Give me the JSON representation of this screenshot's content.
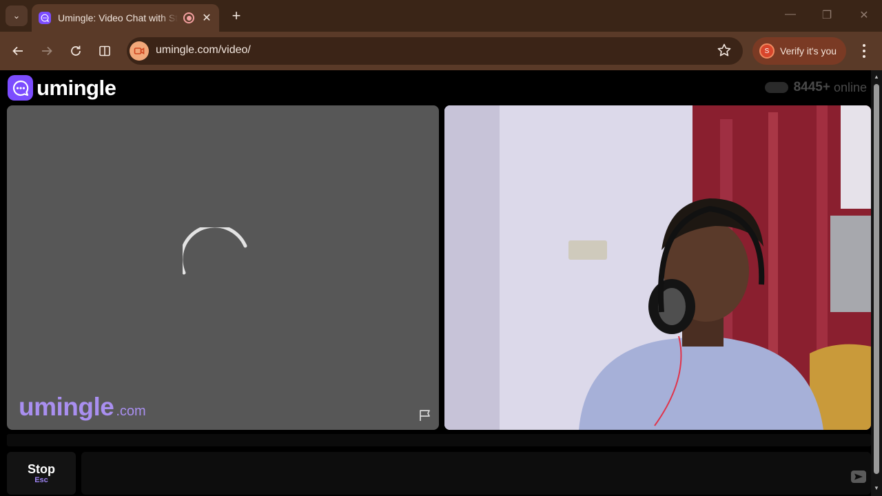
{
  "browser": {
    "tab_title": "Umingle: Video Chat with Strangers",
    "url": "umingle.com/video/",
    "verify_label": "Verify it's you",
    "profile_initial": "S",
    "new_tab_symbol": "+",
    "tab_close_symbol": "✕",
    "tab_search_symbol": "⌄",
    "minimize_symbol": "—",
    "restore_symbol": "❐",
    "close_symbol": "✕"
  },
  "page": {
    "logo_text": "umingle",
    "online_count": "8445+",
    "online_label": "online",
    "watermark_main": "umingle",
    "watermark_tld": ".com",
    "stop_label": "Stop",
    "stop_key": "Esc"
  },
  "colors": {
    "brand": "#7c4dff",
    "watermark": "#a98ff0",
    "chrome_tab_bar": "#3a2517",
    "chrome_toolbar": "#5a3a28"
  },
  "icons": {
    "back": "arrow-left-icon",
    "forward": "arrow-right-icon",
    "reload": "reload-icon",
    "split": "split-view-icon",
    "site": "video-camera-icon",
    "bookmark": "star-icon",
    "menu": "kebab-menu-icon",
    "report": "flag-icon",
    "send": "send-icon",
    "loading": "spinner-icon"
  }
}
